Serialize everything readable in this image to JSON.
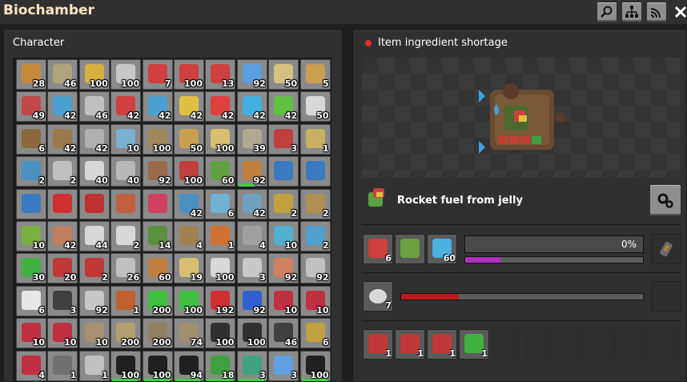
{
  "window": {
    "title": "Biochamber",
    "buttons": [
      {
        "name": "search-icon"
      },
      {
        "name": "tree-icon"
      },
      {
        "name": "signal-icon"
      },
      {
        "name": "close-icon"
      }
    ]
  },
  "character": {
    "title": "Character",
    "rows": [
      [
        {
          "c": "#c48a3a",
          "n": "28"
        },
        {
          "c": "#b0a47a",
          "n": "46"
        },
        {
          "c": "#d8b040",
          "n": "100"
        },
        {
          "c": "#c8c8c8",
          "n": "100"
        },
        {
          "c": "#d04040",
          "n": "7"
        },
        {
          "c": "#d04040",
          "n": "100"
        },
        {
          "c": "#d04040",
          "n": "13"
        },
        {
          "c": "#5aa0e0",
          "n": "92"
        },
        {
          "c": "#d8c080",
          "n": "50"
        },
        {
          "c": "#c8a050",
          "n": "5"
        }
      ],
      [
        {
          "c": "#c04848",
          "n": "49"
        },
        {
          "c": "#4aa0d0",
          "n": "42"
        },
        {
          "c": "#c0c0c0",
          "n": "46"
        },
        {
          "c": "#d04040",
          "n": "42"
        },
        {
          "c": "#4aa0d0",
          "n": "42"
        },
        {
          "c": "#e0c040",
          "n": "42"
        },
        {
          "c": "#e04040",
          "n": "42"
        },
        {
          "c": "#40b0e0",
          "n": "42"
        },
        {
          "c": "#60c040",
          "n": "42"
        },
        {
          "c": "#d8d8d8",
          "n": "50"
        }
      ],
      [
        {
          "c": "#8a6a3a",
          "n": "6"
        },
        {
          "c": "#9a7a4a",
          "n": "42"
        },
        {
          "c": "#b0b0b0",
          "n": "42"
        },
        {
          "c": "#7ab0d0",
          "n": "10"
        },
        {
          "c": "#a08858",
          "n": "100"
        },
        {
          "c": "#c8a050",
          "n": "50"
        },
        {
          "c": "#d8c070",
          "n": "100"
        },
        {
          "c": "#b0a890",
          "n": "39"
        },
        {
          "c": "#c04040",
          "n": "3"
        },
        {
          "c": "#c8b060",
          "n": "1"
        }
      ],
      [
        {
          "c": "#4a90c0",
          "n": "2"
        },
        {
          "c": "#c0c0c0",
          "n": "2"
        },
        {
          "c": "#d8d8d8",
          "n": "40"
        },
        {
          "c": "#b8b8b8",
          "n": "40"
        },
        {
          "c": "#9a6a4a",
          "n": "92"
        },
        {
          "c": "#c04040",
          "n": "100"
        },
        {
          "c": "#60a040",
          "n": "60"
        },
        {
          "c": "#c08040",
          "n": "92",
          "bar": 60
        },
        {
          "c": "#3a7ac0",
          "n": ""
        },
        {
          "c": "#3a7ac0",
          "n": ""
        }
      ],
      [
        {
          "c": "#3a7ac0",
          "n": ""
        },
        {
          "c": "#d03030",
          "n": ""
        },
        {
          "c": "#c03030",
          "n": ""
        },
        {
          "c": "#c06040",
          "n": ""
        },
        {
          "c": "#d04060",
          "n": ""
        },
        {
          "c": "#4a90c0",
          "n": "42"
        },
        {
          "c": "#70b0d0",
          "n": "6"
        },
        {
          "c": "#70a0c0",
          "n": "42"
        },
        {
          "c": "#c0a040",
          "n": "2"
        },
        {
          "c": "#b09050",
          "n": "2"
        }
      ],
      [
        {
          "c": "#7ab040",
          "n": "10"
        },
        {
          "c": "#c08060",
          "n": "42"
        },
        {
          "c": "#d8d8d8",
          "n": "44"
        },
        {
          "c": "#d8d8d8",
          "n": "2"
        },
        {
          "c": "#5a9040",
          "n": "14"
        },
        {
          "c": "#a08050",
          "n": "4"
        },
        {
          "c": "#d07030",
          "n": "1"
        },
        {
          "c": "#a0a0a0",
          "n": "4"
        },
        {
          "c": "#50b0d0",
          "n": "10"
        },
        {
          "c": "#50a0d0",
          "n": "2"
        }
      ],
      [
        {
          "c": "#40b040",
          "n": "30"
        },
        {
          "c": "#c03838",
          "n": "20"
        },
        {
          "c": "#c03838",
          "n": "2"
        },
        {
          "c": "#c0c0c0",
          "n": "26"
        },
        {
          "c": "#c08040",
          "n": "60"
        },
        {
          "c": "#d8c070",
          "n": "19"
        },
        {
          "c": "#d8d8d8",
          "n": "100"
        },
        {
          "c": "#c8c8c8",
          "n": "3"
        },
        {
          "c": "#d08060",
          "n": "92"
        },
        {
          "c": "#c0c0c0",
          "n": "92"
        }
      ],
      [
        {
          "c": "#e8e8e8",
          "n": "6"
        },
        {
          "c": "#404040",
          "n": "3"
        },
        {
          "c": "#c8c8c8",
          "n": "92"
        },
        {
          "c": "#c06030",
          "n": "1"
        },
        {
          "c": "#40c040",
          "n": "200"
        },
        {
          "c": "#40c040",
          "n": "100"
        },
        {
          "c": "#d03030",
          "n": "192"
        },
        {
          "c": "#3060d0",
          "n": "92"
        },
        {
          "c": "#c03040",
          "n": "10"
        },
        {
          "c": "#c03040",
          "n": "10"
        }
      ],
      [
        {
          "c": "#c03040",
          "n": "10"
        },
        {
          "c": "#c03040",
          "n": "10"
        },
        {
          "c": "#a89070",
          "n": "10"
        },
        {
          "c": "#b0a070",
          "n": "200"
        },
        {
          "c": "#908060",
          "n": "200"
        },
        {
          "c": "#a09070",
          "n": "74"
        },
        {
          "c": "#303030",
          "n": "100"
        },
        {
          "c": "#303030",
          "n": "100"
        },
        {
          "c": "#404040",
          "n": "46"
        },
        {
          "c": "#c0a040",
          "n": "6"
        }
      ],
      [
        {
          "c": "#c03040",
          "n": "4"
        },
        {
          "c": "#707070",
          "n": "1"
        },
        {
          "c": "#c0c0c0",
          "n": "1"
        },
        {
          "c": "#202020",
          "n": "100",
          "bar": 95
        },
        {
          "c": "#202020",
          "n": "100",
          "bar": 95
        },
        {
          "c": "#202020",
          "n": "94",
          "bar": 90
        },
        {
          "c": "#40a040",
          "n": "18",
          "bar": 95
        },
        {
          "c": "#40a080",
          "n": "3",
          "bar": 95
        },
        {
          "c": "#60a0e0",
          "n": "3"
        },
        {
          "c": "#202020",
          "n": "100",
          "bar": 95
        }
      ]
    ]
  },
  "machine": {
    "status_text": "Item ingredient shortage",
    "status_color": "#e03030",
    "recipe_name": "Rocket fuel from jelly",
    "settings_icon": "gear-icon",
    "inputs": [
      {
        "icon": "red-cluster-icon",
        "color": "#d04040",
        "count": "6"
      },
      {
        "icon": "green-cube-icon",
        "color": "#6aa040",
        "count": ""
      },
      {
        "icon": "water-drop-icon",
        "color": "#4ab0e0",
        "count": "60"
      }
    ],
    "crafting_progress_text": "0%",
    "crafting_progress": 0,
    "productivity_progress": 0.2,
    "productivity_color": "#b030c0",
    "module_icon": "fuel-icon",
    "fuel": {
      "icon": "nutrient-icon",
      "color": "#d8d8d8",
      "count": "7"
    },
    "fuel_progress": 0.24,
    "fuel_progress_color": "#c01818",
    "outputs": [
      {
        "color": "#c03838",
        "count": "1"
      },
      {
        "color": "#c03838",
        "count": "1"
      },
      {
        "color": "#c03838",
        "count": "1"
      },
      {
        "color": "#40b040",
        "count": "1"
      }
    ]
  }
}
